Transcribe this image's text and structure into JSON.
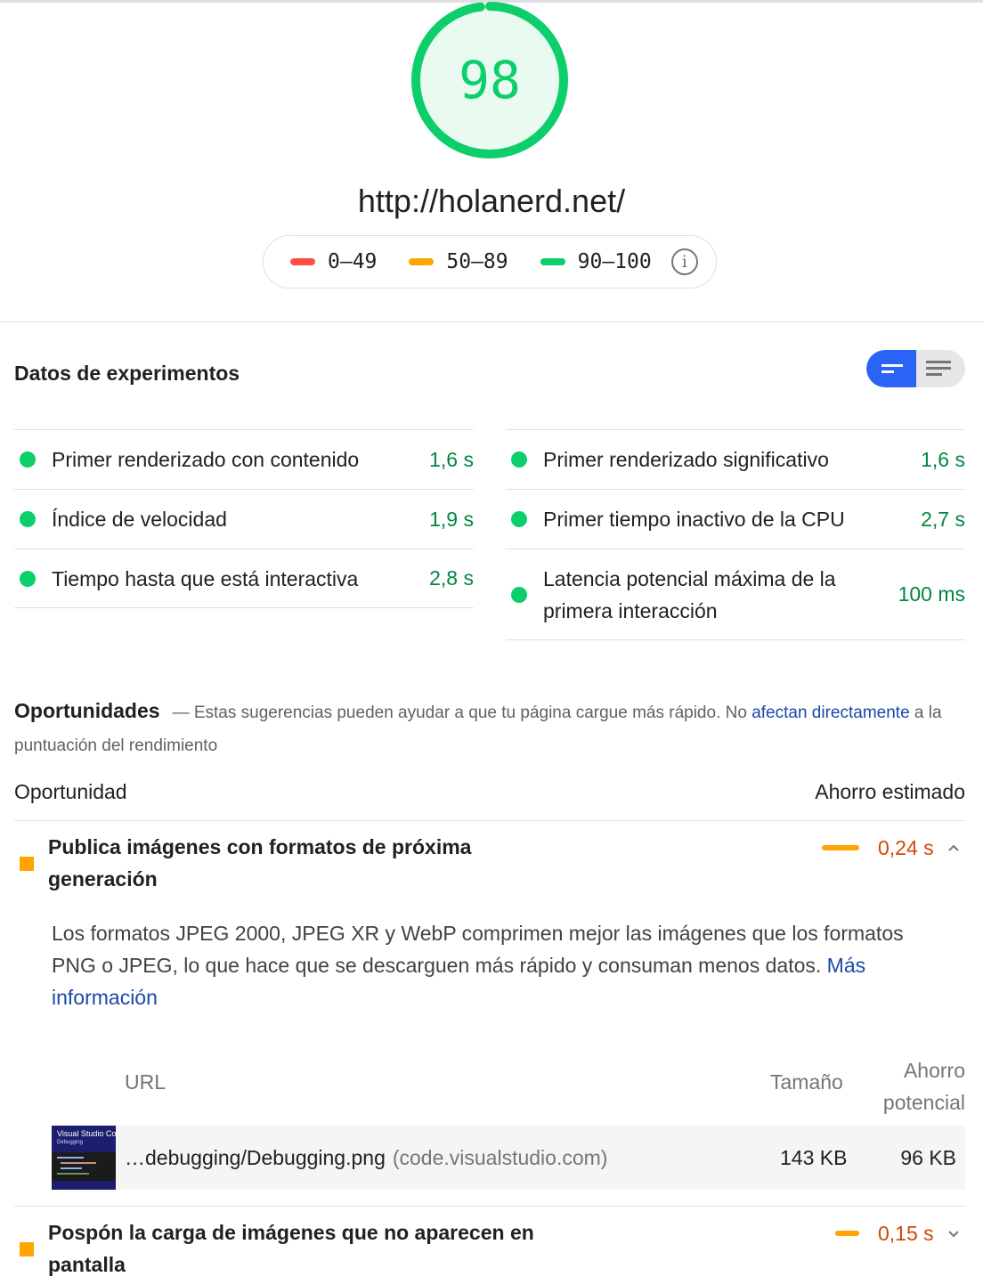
{
  "score": {
    "value": "98",
    "fraction": 0.98,
    "color": "#0cce6b",
    "fill": "#e9faf0"
  },
  "site_url": "http://holanerd.net/",
  "legend": [
    {
      "label": "0–49",
      "color": "#ff4e42"
    },
    {
      "label": "50–89",
      "color": "#ffa400"
    },
    {
      "label": "90–100",
      "color": "#0cce6b"
    }
  ],
  "lab_data": {
    "title": "Datos de experimentos",
    "metrics_left": [
      {
        "label": "Primer renderizado con contenido",
        "value": "1,6 s"
      },
      {
        "label": "Índice de velocidad",
        "value": "1,9 s"
      },
      {
        "label": "Tiempo hasta que está interactiva",
        "value": "2,8 s"
      }
    ],
    "metrics_right": [
      {
        "label": "Primer renderizado significativo",
        "value": "1,6 s"
      },
      {
        "label": "Primer tiempo inactivo de la CPU",
        "value": "2,7 s"
      },
      {
        "label": "Latencia potencial máxima de la primera interacción",
        "value": "100 ms"
      }
    ]
  },
  "opportunities": {
    "heading": "Oportunidades",
    "intro_prefix": "— Estas sugerencias pueden ayudar a que tu página cargue más rápido. No ",
    "intro_link": "afectan directamente",
    "intro_suffix": " a la puntuación del rendimiento",
    "col_opportunity": "Oportunidad",
    "col_savings": "Ahorro estimado"
  },
  "audit1": {
    "title": "Publica imágenes con formatos de próxima generación",
    "saving": "0,24 s",
    "desc_text": "Los formatos JPEG 2000, JPEG XR y WebP comprimen mejor las imágenes que los formatos PNG o JPEG, lo que hace que se descarguen más rápido y consuman menos datos. ",
    "desc_link": "Más información",
    "table": {
      "col_url": "URL",
      "col_size": "Tamaño",
      "col_savings": "Ahorro potencial",
      "row": {
        "thumb_title": "Visual Studio Code",
        "thumb_subtitle": "Debugging",
        "url": "…debugging/Debugging.png",
        "host": "(code.visualstudio.com)",
        "size": "143 KB",
        "savings": "96 KB"
      }
    }
  },
  "audit2": {
    "title": "Pospón la carga de imágenes que no aparecen en pantalla",
    "saving": "0,15 s"
  }
}
